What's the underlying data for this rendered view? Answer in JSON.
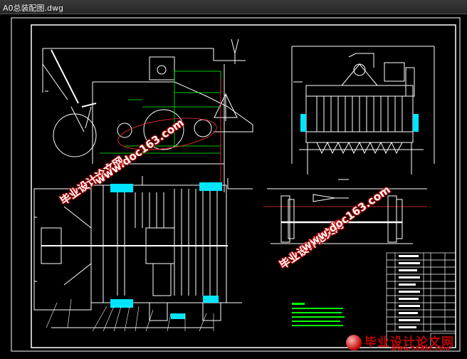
{
  "window": {
    "title": "A0总装配图.dwg"
  },
  "watermarks": [
    {
      "text": "毕业设计论文网"
    },
    {
      "text": "www.doc163.com"
    }
  ],
  "footer": {
    "brand": "毕业设计论文网",
    "url": "www.56doc.com"
  },
  "colors": {
    "background": "#000000",
    "lines": "#ffffff",
    "cyan": "#00e5ff",
    "green": "#00ff00",
    "red": "#ff3030",
    "watermark": "#c00000"
  }
}
